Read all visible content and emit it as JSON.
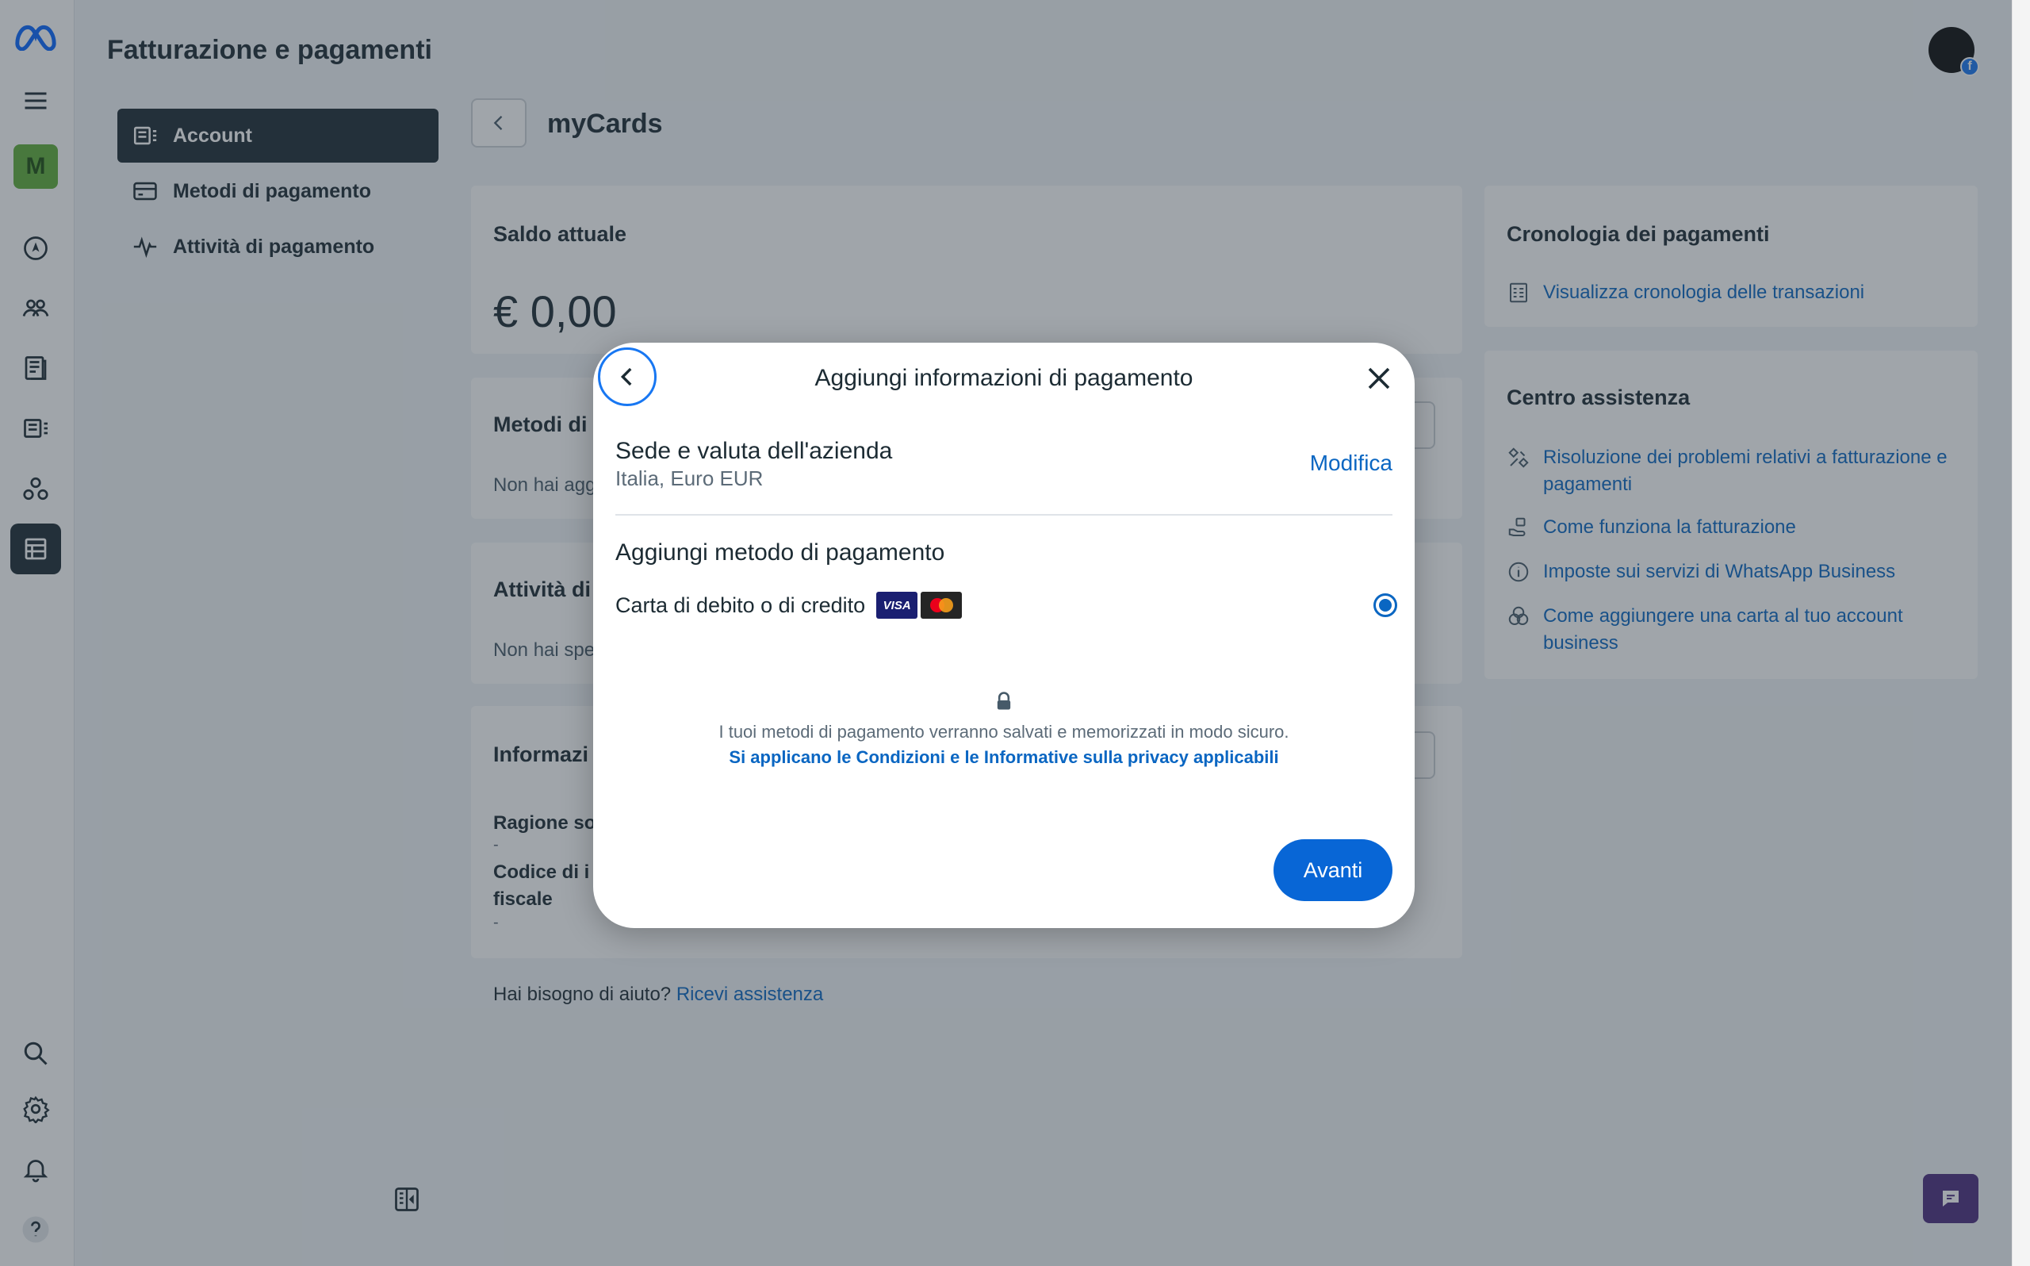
{
  "header": {
    "title": "Fatturazione e pagamenti",
    "rail_badge": "M",
    "profile_badge": "f"
  },
  "nav": {
    "items": [
      {
        "label": "Account",
        "icon": "account-icon",
        "active": true
      },
      {
        "label": "Metodi di pagamento",
        "icon": "credit-card-icon",
        "active": false
      },
      {
        "label": "Attività di pagamento",
        "icon": "activity-pulse-icon",
        "active": false
      }
    ]
  },
  "main": {
    "section_title": "myCards",
    "balance_card": {
      "title": "Saldo attuale",
      "amount": "€ 0,00"
    },
    "methods_card": {
      "title": "Metodi di",
      "note": "Non hai agg"
    },
    "activity_card": {
      "title": "Attività di",
      "note": "Non hai spe"
    },
    "info_card": {
      "title": "Informazi",
      "field1_label": "Ragione so",
      "field1_value": "-",
      "field2_label": "Codice di i",
      "field2_label_cont": "fiscale",
      "field2_value": "-"
    },
    "help": {
      "text": "Hai bisogno di aiuto?",
      "link": "Ricevi assistenza"
    }
  },
  "right": {
    "history": {
      "title": "Cronologia dei pagamenti",
      "link": "Visualizza cronologia delle transazioni"
    },
    "help_center": {
      "title": "Centro assistenza",
      "links": [
        "Risoluzione dei problemi relativi a fatturazione e pagamenti",
        "Come funziona la fatturazione",
        "Imposte sui servizi di WhatsApp Business",
        "Come aggiungere una carta al tuo account business"
      ]
    }
  },
  "modal": {
    "title": "Aggiungi informazioni di pagamento",
    "business_heading": "Sede e valuta dell'azienda",
    "business_value": "Italia, Euro EUR",
    "edit_label": "Modifica",
    "payment_heading": "Aggiungi metodo di pagamento",
    "card_option": "Carta di debito o di credito",
    "card_brands": [
      "VISA",
      "Mastercard"
    ],
    "secure_note": "I tuoi metodi di pagamento verranno salvati e memorizzati in modo sicuro.",
    "terms_link": "Si applicano le Condizioni e le Informative sulla privacy applicabili",
    "next_button": "Avanti"
  },
  "colors": {
    "accent": "#0a66c2",
    "dark": "#1c2b33",
    "primary_button": "#0866d6",
    "chat": "#4b2d7f"
  }
}
